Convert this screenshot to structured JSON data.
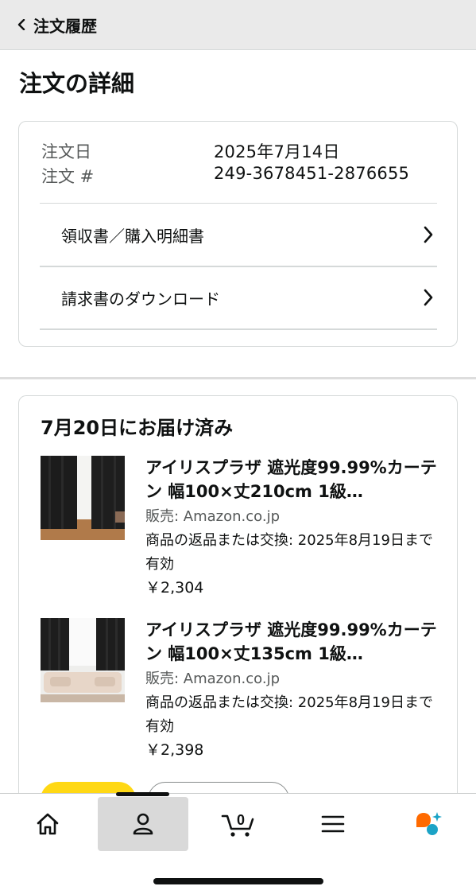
{
  "header": {
    "back_label": "注文履歴"
  },
  "page": {
    "title": "注文の詳細"
  },
  "order": {
    "date_label": "注文日",
    "date_value": "2025年7月14日",
    "number_label": "注文 #",
    "number_value": "249-3678451-2876655",
    "links": [
      {
        "label": "領収書／購入明細書"
      },
      {
        "label": "請求書のダウンロード"
      }
    ]
  },
  "shipment": {
    "status": "7月20日にお届け済み",
    "items": [
      {
        "title": "アイリスプラザ 遮光度99.99%カーテン 幅100×丈210cm 1級…",
        "seller": "販売: Amazon.co.jp",
        "return_policy": "商品の返品または交換: 2025年8月19日まで有効",
        "price": "￥2,304"
      },
      {
        "title": "アイリスプラザ 遮光度99.99%カーテン 幅100×丈135cm 1級…",
        "seller": "販売: Amazon.co.jp",
        "return_policy": "商品の返品または交換: 2025年8月19日まで有効",
        "price": "￥2,398"
      }
    ]
  },
  "nav": {
    "cart_count": "0",
    "items": [
      "home-icon",
      "account-icon",
      "cart-icon",
      "menu-icon",
      "rufus-icon"
    ],
    "active": "account-icon"
  },
  "colors": {
    "accent_yellow": "#ffd814",
    "rufus_orange": "#ff6a00",
    "rufus_teal": "#1ba3c6",
    "header_bg": "#eaeaea"
  }
}
